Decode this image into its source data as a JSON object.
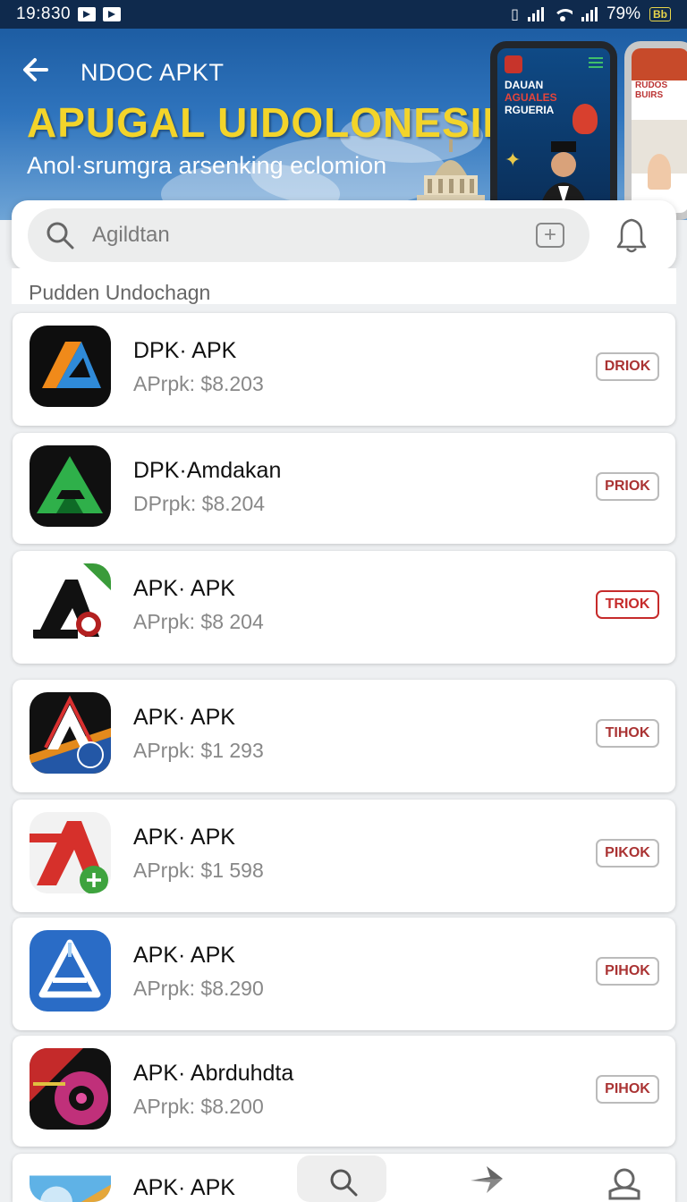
{
  "status_bar": {
    "time": "19:830",
    "battery": "79%",
    "battery_badge": "Bb"
  },
  "header": {
    "app_title": "NDOC APKT",
    "banner_heading": "APUGAL UIDOLONESIN",
    "banner_subtitle": "Anol·srumgra arsenking eclomion",
    "promo_lines": [
      "DAUAN",
      "AGUALES",
      "RGUERIA"
    ],
    "promo_side_text": "RUDOS BUIRS"
  },
  "search": {
    "placeholder": "Agildtan"
  },
  "section_title": "Pudden Undochagn",
  "apps": [
    {
      "name": "DPK· APK",
      "price": "APrpk: $8.203",
      "action": "DRIOK",
      "active": false
    },
    {
      "name": "DPK·Amdakan",
      "price": "DPrpk: $8.204",
      "action": "PRIOK",
      "active": false
    },
    {
      "name": "APK· APK",
      "price": "APrpk: $8 204",
      "action": "TRIOK",
      "active": true
    },
    {
      "name": "APK· APK",
      "price": "APrpk: $1 293",
      "action": "TIHOK",
      "active": false
    },
    {
      "name": "APK· APK",
      "price": "APrpk: $1 598",
      "action": "PIKOK",
      "active": false
    },
    {
      "name": "APK· APK",
      "price": "APrpk: $8.290",
      "action": "PIHOK",
      "active": false
    },
    {
      "name": "APK· Abrduhdta",
      "price": "APrpk: $8.200",
      "action": "PIHOK",
      "active": false
    },
    {
      "name": "APK· APK",
      "price": "",
      "action": "",
      "active": false
    }
  ],
  "icons": {
    "status": [
      "media-icon",
      "media-icon",
      "vibrate-icon",
      "signal-icon",
      "wifi-icon",
      "signal-icon",
      "battery-icon"
    ],
    "nav": [
      "search-icon",
      "send-icon",
      "profile-icon"
    ]
  },
  "colors": {
    "header_dark": "#0f2a4d",
    "header_blue": "#2f74bd",
    "accent_yellow": "#f3d42a",
    "active_red": "#c62b2b"
  }
}
